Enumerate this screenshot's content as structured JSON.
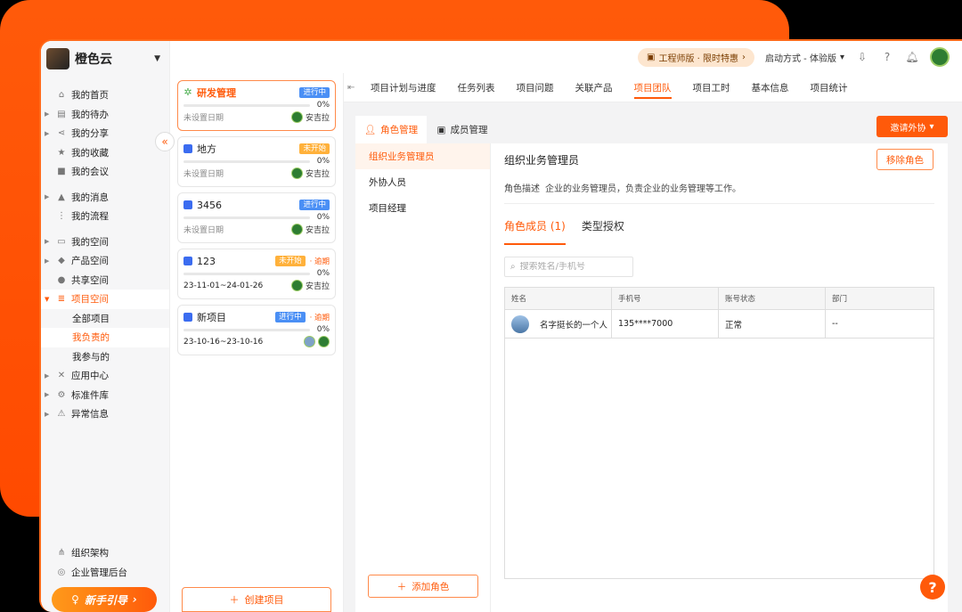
{
  "app": {
    "name": "橙色云"
  },
  "topbar": {
    "promo": "工程师版 · 限时特惠",
    "launch": "启动方式 - 体验版"
  },
  "sidebar": {
    "items": [
      {
        "label": "我的首页",
        "icon": "home-icon"
      },
      {
        "label": "我的待办",
        "icon": "todo-icon"
      },
      {
        "label": "我的分享",
        "icon": "share-icon"
      },
      {
        "label": "我的收藏",
        "icon": "star-icon"
      },
      {
        "label": "我的会议",
        "icon": "video-icon"
      },
      {
        "label": "我的消息",
        "icon": "bell-icon"
      },
      {
        "label": "我的流程",
        "icon": "flow-icon"
      },
      {
        "label": "我的空间",
        "icon": "box-icon"
      },
      {
        "label": "产品空间",
        "icon": "cube-icon"
      },
      {
        "label": "共享空间",
        "icon": "people-icon"
      },
      {
        "label": "项目空间",
        "icon": "stack-icon"
      },
      {
        "label": "应用中心",
        "icon": "apps-icon"
      },
      {
        "label": "标准件库",
        "icon": "gear-icon"
      },
      {
        "label": "异常信息",
        "icon": "warning-icon"
      }
    ],
    "sub_items": [
      "全部项目",
      "我负责的",
      "我参与的"
    ],
    "bottom": [
      "组织架构",
      "企业管理后台"
    ],
    "guide": "新手引导"
  },
  "projects": [
    {
      "name": "研发管理",
      "status": "进行中",
      "status_color": "#4a8ff5",
      "progress": "0%",
      "date": "未设置日期",
      "owner": "安吉拉",
      "overdue": ""
    },
    {
      "name": "地方",
      "status": "未开始",
      "status_color": "#ffb13b",
      "progress": "0%",
      "date": "未设置日期",
      "owner": "安吉拉",
      "overdue": ""
    },
    {
      "name": "3456",
      "status": "进行中",
      "status_color": "#4a8ff5",
      "progress": "0%",
      "date": "未设置日期",
      "owner": "安吉拉",
      "overdue": ""
    },
    {
      "name": "123",
      "status": "未开始",
      "status_color": "#ffb13b",
      "progress": "0%",
      "date": "23-11-01~24-01-26",
      "owner": "安吉拉",
      "overdue": "· 逾期"
    },
    {
      "name": "新项目",
      "status": "进行中",
      "status_color": "#4a8ff5",
      "progress": "0%",
      "date": "23-10-16~23-10-16",
      "owner": "",
      "overdue": "· 逾期"
    }
  ],
  "create_project": "创建项目",
  "tabs": [
    "项目计划与进度",
    "任务列表",
    "项目问题",
    "关联产品",
    "项目团队",
    "项目工时",
    "基本信息",
    "项目统计"
  ],
  "subtabs": {
    "role": "角色管理",
    "member": "成员管理"
  },
  "invite": "邀请外协",
  "roles": [
    "组织业务管理员",
    "外协人员",
    "项目经理"
  ],
  "add_role": "添加角色",
  "detail": {
    "title": "组织业务管理员",
    "remove": "移除角色",
    "desc_label": "角色描述",
    "desc": "企业的业务管理员，负责企业的业务管理等工作。",
    "tab_members": "角色成员 (1)",
    "tab_auth": "类型授权",
    "search_placeholder": "搜索姓名/手机号",
    "columns": [
      "姓名",
      "手机号",
      "账号状态",
      "部门"
    ],
    "rows": [
      {
        "name": "名字挺长的一个人",
        "phone": "135****7000",
        "status": "正常",
        "dept": "--"
      }
    ]
  },
  "colors": {
    "accent": "#ff5a0a",
    "blue_badge": "#4a8ff5",
    "orange_badge": "#ffb13b"
  }
}
